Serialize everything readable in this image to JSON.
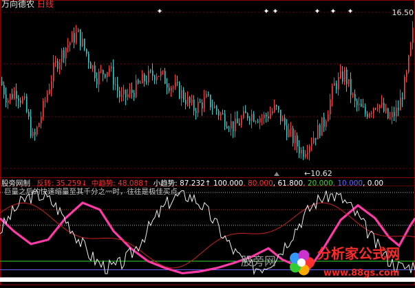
{
  "header": {
    "stock_name": "万向德农",
    "period": "日线"
  },
  "price_panel": {
    "high_label": "16.50",
    "low_label": "←10.62",
    "ylim": [
      10.2,
      17.0
    ],
    "marker_count": 6
  },
  "indicator": {
    "name": "股旁网制",
    "items": [
      {
        "label": "反转:",
        "value": "35.259",
        "arrow": "↓",
        "color": "#ff3030"
      },
      {
        "label": "中趋势:",
        "value": "48.088",
        "arrow": "↑",
        "color": "#ff3030"
      },
      {
        "label": "小趋势:",
        "value": "87.232",
        "arrow": "↑",
        "color": "#ffffff"
      }
    ],
    "levels": [
      "100.000",
      "80.000",
      "61.800",
      "20.000",
      "10.000",
      "0.00"
    ],
    "level_colors": [
      "#ffffff",
      "#ff3030",
      "#ffffff",
      "#33dd33",
      "#6666ff",
      "#ffffff"
    ],
    "note": "巨量之后的快速缩量至其千分之一时，往往是极佳买点。"
  },
  "watermark": {
    "text": "股旁网",
    "logo": "分析家公式网",
    "url": "www.88gs.com"
  },
  "colors": {
    "up": "#ff4040",
    "down": "#33cccc",
    "pink": "#ff3aa8",
    "red_line": "#cc2020",
    "white_line": "#f0f0f0",
    "gridline": "#7a0000"
  }
}
